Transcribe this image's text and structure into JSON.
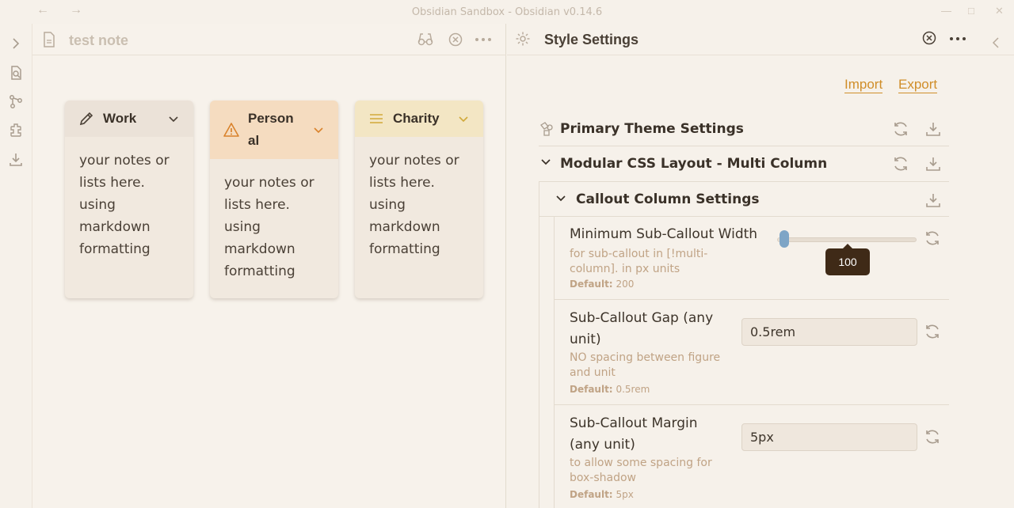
{
  "window": {
    "title": "Obsidian Sandbox - Obsidian v0.14.6"
  },
  "left_pane": {
    "note_title": "test note",
    "cards": [
      {
        "title": "Work",
        "icon": "pencil-icon",
        "body": "your notes or lists here. using markdown formatting",
        "header_color": "#ebe2d8",
        "accent": "#4a4036"
      },
      {
        "title": "Person al",
        "icon": "warning-icon",
        "body": "your notes or lists here. using markdown formatting",
        "header_color": "#f5dcc0",
        "accent": "#d9822b"
      },
      {
        "title": "Charity",
        "icon": "list-icon",
        "body": "your notes or lists here. using markdown formatting",
        "header_color": "#f3e6c4",
        "accent": "#d1a93a"
      }
    ]
  },
  "right_pane": {
    "title": "Style Settings",
    "import_label": "Import",
    "export_label": "Export",
    "sections": {
      "primary": "Primary Theme Settings",
      "modular": "Modular CSS Layout - Multi Column",
      "callout": "Callout Column Settings"
    },
    "settings": {
      "min_width": {
        "name": "Minimum Sub-Callout Width",
        "desc": "for sub-callout in [!multi-column]. in px units",
        "default_label": "Default:",
        "default_value": "200",
        "slider_value": "100",
        "slider_fraction": 0.05
      },
      "gap": {
        "name": "Sub-Callout Gap (any unit)",
        "desc": "NO spacing between figure and unit",
        "default_label": "Default:",
        "default_value": "0.5rem",
        "value": "0.5rem"
      },
      "margin": {
        "name": "Sub-Callout Margin (any unit)",
        "desc": "to allow some spacing for box-shadow",
        "default_label": "Default:",
        "default_value": "5px",
        "value": "5px"
      }
    }
  }
}
